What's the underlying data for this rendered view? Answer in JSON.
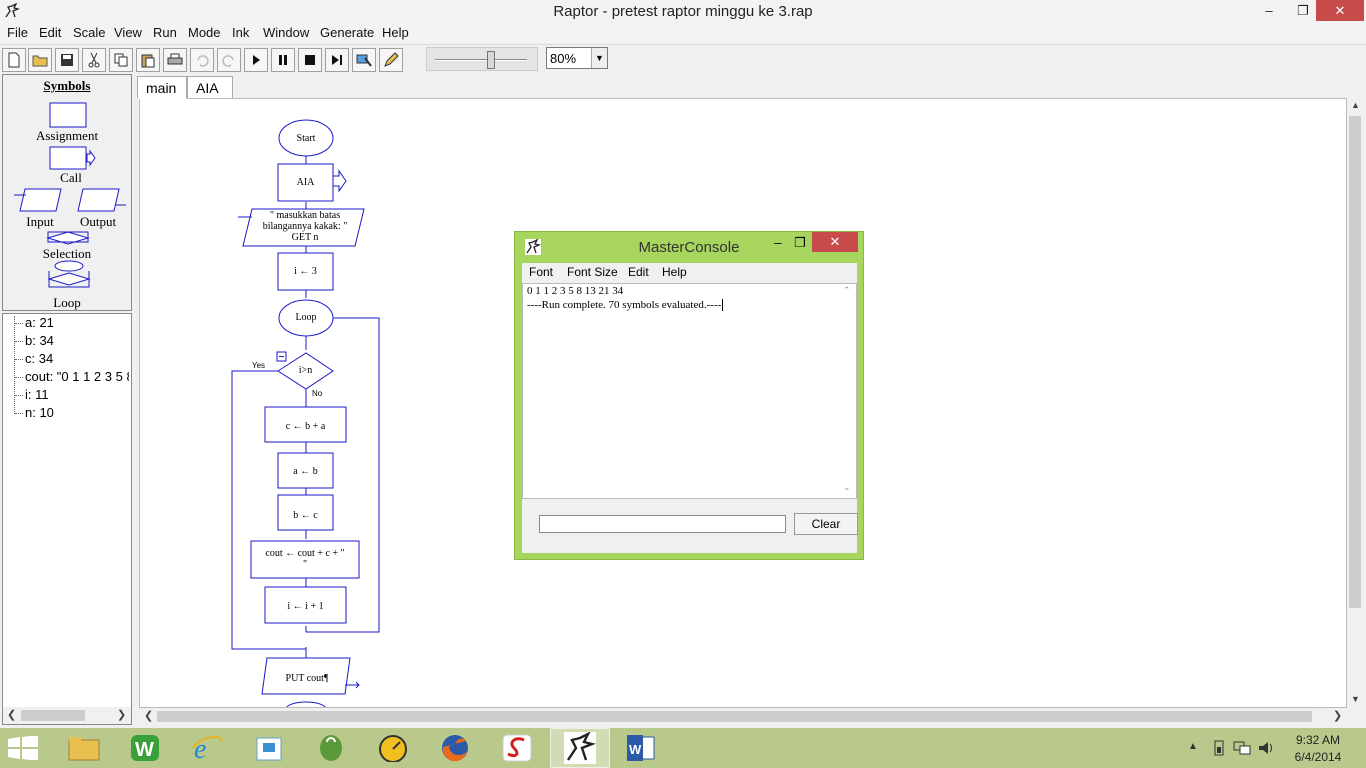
{
  "window": {
    "title": "Raptor - pretest raptor minggu ke 3.rap",
    "minimize": "–",
    "maximize": "❐",
    "close": "✕"
  },
  "menu": [
    "File",
    "Edit",
    "Scale",
    "View",
    "Run",
    "Mode",
    "Ink",
    "Window",
    "Generate",
    "Help"
  ],
  "toolbar": {
    "zoom": "80%",
    "icons": [
      "new-icon",
      "open-icon",
      "save-icon",
      "cut-icon",
      "copy-icon",
      "paste-icon",
      "print-icon",
      "undo-icon",
      "redo-icon",
      "play-icon",
      "pause-icon",
      "stop-icon",
      "step-icon",
      "test-icon",
      "pen-icon"
    ]
  },
  "symbols": {
    "heading": "Symbols",
    "assignment": "Assignment",
    "call": "Call",
    "input": "Input",
    "output": "Output",
    "selection": "Selection",
    "loop": "Loop"
  },
  "variables": [
    {
      "text": "a: 21"
    },
    {
      "text": "b: 34"
    },
    {
      "text": "c: 34"
    },
    {
      "text": "cout: \"0 1 1 2 3 5 8"
    },
    {
      "text": "i: 11"
    },
    {
      "text": "n: 10"
    }
  ],
  "tabs": [
    {
      "label": "main"
    },
    {
      "label": "AIA"
    }
  ],
  "flowchart": {
    "start": "Start",
    "call": "AIA",
    "input_line1": "\" masukkan batas",
    "input_line2": "bilangannya kakak: \"",
    "input_line3": "GET n",
    "assign_i": "i ← 3",
    "loop": "Loop",
    "decision": "i>n",
    "yes": "Yes",
    "no": "No",
    "assign_c": "c ← b + a",
    "assign_a": "a ← b",
    "assign_b": "b ← c",
    "assign_cout_line1": "cout ← cout  +  c  +  \"",
    "assign_cout_line2": "\"",
    "assign_inc": "i ← i + 1",
    "output": "PUT cout¶"
  },
  "console": {
    "title": "MasterConsole",
    "menu": [
      "Font",
      "Font Size",
      "Edit",
      "Help"
    ],
    "line1": "0 1 1 2 3 5 8 13 21 34",
    "line2": "----Run complete.  70 symbols evaluated.----",
    "clear": "Clear"
  },
  "taskbar": {
    "time": "9:32 AM",
    "date": "6/4/2014"
  }
}
